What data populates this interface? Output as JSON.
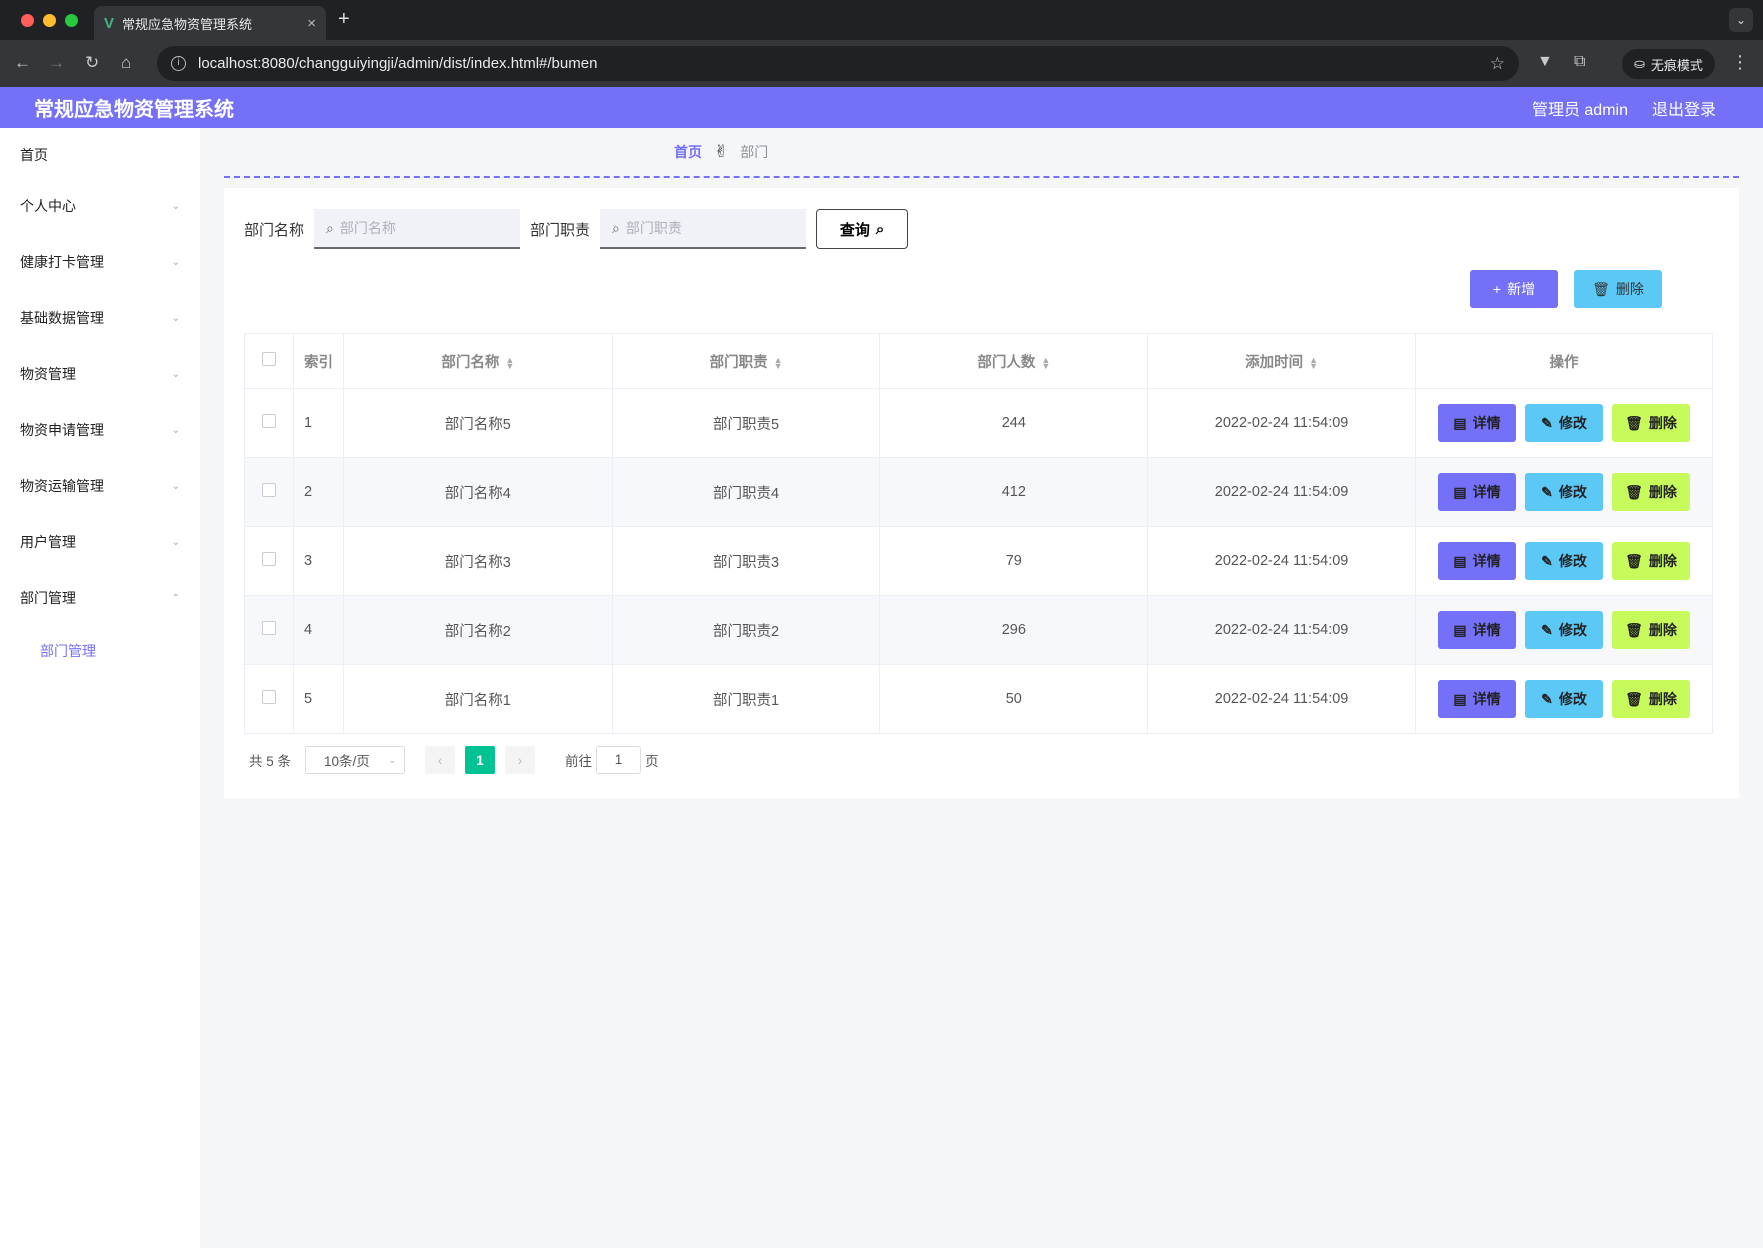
{
  "browser": {
    "tab_title": "常规应急物资管理系统",
    "tab_close": "×",
    "new_tab": "+",
    "url": "localhost:8080/changguiyingji/admin/dist/index.html#/bumen",
    "incognito_label": "无痕模式",
    "traffic_colors": [
      "#ff5f57",
      "#febc2e",
      "#28c840"
    ]
  },
  "header": {
    "title": "常规应急物资管理系统",
    "user": "管理员 admin",
    "logout": "退出登录",
    "color": "#7470f7"
  },
  "sidebar": {
    "items": [
      {
        "label": "首页"
      },
      {
        "label": "个人中心"
      },
      {
        "label": "健康打卡管理"
      },
      {
        "label": "基础数据管理"
      },
      {
        "label": "物资管理"
      },
      {
        "label": "物资申请管理"
      },
      {
        "label": "物资运输管理"
      },
      {
        "label": "用户管理"
      },
      {
        "label": "部门管理"
      }
    ],
    "subitem": "部门管理"
  },
  "breadcrumb": {
    "home": "首页",
    "separator": "✌",
    "current": "部门"
  },
  "search": {
    "name_label": "部门名称",
    "name_placeholder": "部门名称",
    "duty_label": "部门职责",
    "duty_placeholder": "部门职责",
    "query_label": "查询"
  },
  "actions": {
    "add": "新增",
    "delete": "删除"
  },
  "table": {
    "headers": [
      "索引",
      "部门名称",
      "部门职责",
      "部门人数",
      "添加时间",
      "操作"
    ],
    "op_labels": {
      "detail": "详情",
      "edit": "修改",
      "delete": "删除"
    },
    "rows": [
      {
        "index": "1",
        "name": "部门名称5",
        "duty": "部门职责5",
        "count": "244",
        "time": "2022-02-24 11:54:09"
      },
      {
        "index": "2",
        "name": "部门名称4",
        "duty": "部门职责4",
        "count": "412",
        "time": "2022-02-24 11:54:09"
      },
      {
        "index": "3",
        "name": "部门名称3",
        "duty": "部门职责3",
        "count": "79",
        "time": "2022-02-24 11:54:09"
      },
      {
        "index": "4",
        "name": "部门名称2",
        "duty": "部门职责2",
        "count": "296",
        "time": "2022-02-24 11:54:09"
      },
      {
        "index": "5",
        "name": "部门名称1",
        "duty": "部门职责1",
        "count": "50",
        "time": "2022-02-24 11:54:09"
      }
    ]
  },
  "pager": {
    "total": "共 5 条",
    "page_size": "10条/页",
    "current_page": "1",
    "goto_prefix": "前往",
    "goto_value": "1",
    "goto_suffix": "页"
  }
}
